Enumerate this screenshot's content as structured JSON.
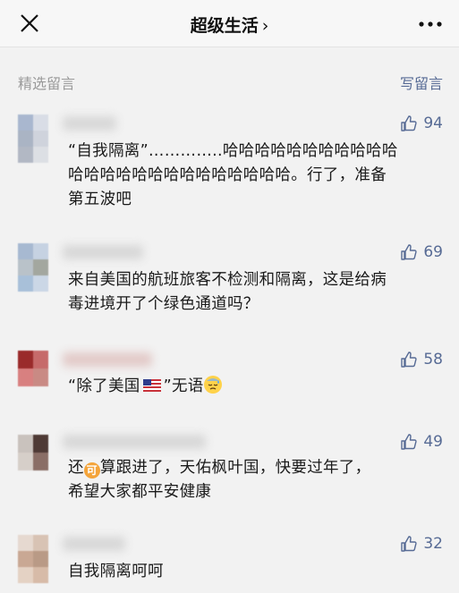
{
  "header": {
    "title": "超级生活",
    "title_chevron": "›"
  },
  "section": {
    "label": "精选留言",
    "write_label": "写留言"
  },
  "comments": [
    {
      "likes": "94",
      "line1": "“自我隔离”…………..哈哈哈哈哈哈哈哈哈哈哈",
      "line2": "哈哈哈哈哈哈哈哈哈哈哈哈哈哈。行了，准备",
      "line3": "第五波吧",
      "avatar_colors": [
        "#a9b7cf",
        "#d9dde6",
        "#aab4c4",
        "#cfd3dc",
        "#b2b8c4",
        "#dcdfe4"
      ]
    },
    {
      "likes": "69",
      "line1": "来自美国的航班旅客不检测和隔离，这是给病",
      "line2": "毒进境开了个绿色通道吗？",
      "avatar_colors": [
        "#a7b9d1",
        "#c6d2e2",
        "#b9c2c9",
        "#a3a79f",
        "#a8c0d9",
        "#cbd7e6"
      ]
    },
    {
      "likes": "58",
      "text_before_flag": "“除了美国",
      "flag_icon": "us-flag-icon",
      "text_after_flag": "”无语",
      "emoji_icon": "sweat-face-icon",
      "avatar_colors": [
        "#9a2b2b",
        "#c66a6a",
        "#d88080",
        "#c98a84",
        "#e9b4b0",
        "#d99c98"
      ]
    },
    {
      "likes": "49",
      "text_before_emoji": "还",
      "emoji_icon": "coin-emoji-icon",
      "emoji_char": "可",
      "text_after_emoji": "算跟进了，天佑枫叶国，快要过年了，",
      "line2": "希望大家都平安健康",
      "avatar_colors": [
        "#c9c2bd",
        "#4e3a35",
        "#d6cfc9",
        "#8a6e66",
        "#e0dad5",
        "#a9928a"
      ]
    },
    {
      "likes": "32",
      "line1": "自我隔离呵呵",
      "avatar_colors": [
        "#e6d9d0",
        "#d8c3b4",
        "#c9a894",
        "#b99a86",
        "#e4d2c4",
        "#d7bba8"
      ]
    }
  ],
  "colors": {
    "link": "#576b95",
    "muted": "#9a9a9a",
    "background": "#f2f2f2"
  }
}
